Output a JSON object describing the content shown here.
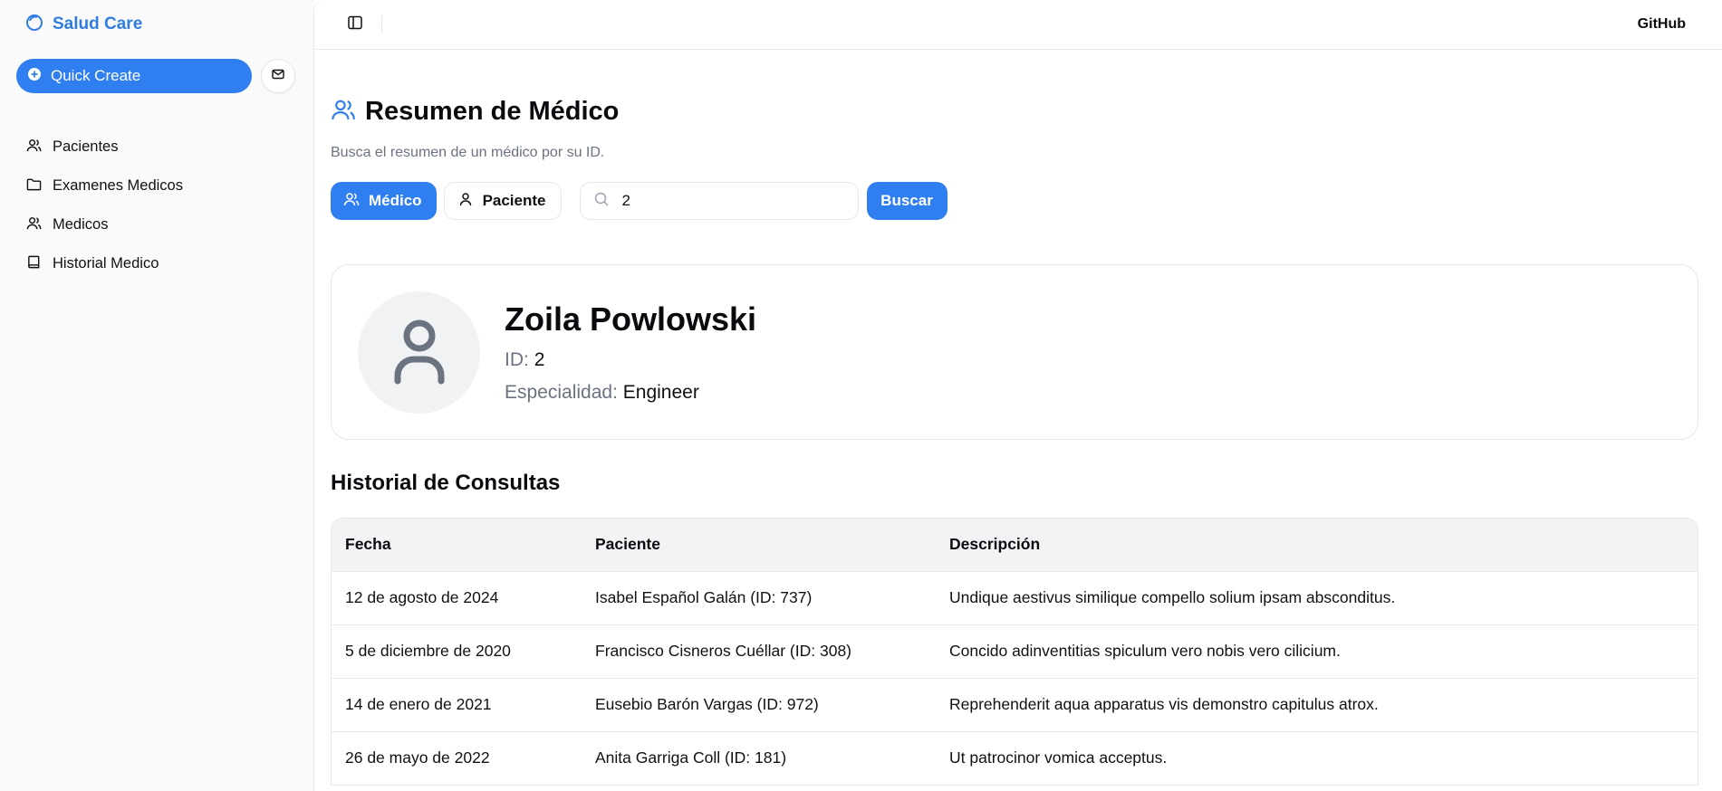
{
  "brand": {
    "name": "Salud Care",
    "color": "#2f7de1"
  },
  "sidebar": {
    "quick_create": "Quick Create",
    "items": [
      {
        "label": "Pacientes",
        "icon": "users-icon"
      },
      {
        "label": "Examenes Medicos",
        "icon": "folder-icon"
      },
      {
        "label": "Medicos",
        "icon": "users-icon"
      },
      {
        "label": "Historial Medico",
        "icon": "book-icon"
      }
    ]
  },
  "topbar": {
    "github": "GitHub"
  },
  "page": {
    "title": "Resumen de Médico",
    "subtitle": "Busca el resumen de un médico por su ID."
  },
  "filters": {
    "medico_label": "Médico",
    "paciente_label": "Paciente",
    "search_value": "2",
    "search_button": "Buscar"
  },
  "doctor": {
    "name": "Zoila Powlowski",
    "id_label": "ID:",
    "id_value": "2",
    "specialty_label": "Especialidad:",
    "specialty_value": "Engineer"
  },
  "history": {
    "title": "Historial de Consultas",
    "headers": [
      "Fecha",
      "Paciente",
      "Descripción"
    ],
    "rows": [
      [
        "12 de agosto de 2024",
        "Isabel Español Galán (ID: 737)",
        "Undique aestivus similique compello solium ipsam absconditus."
      ],
      [
        "5 de diciembre de 2020",
        "Francisco Cisneros Cuéllar (ID: 308)",
        "Concido adinventitias spiculum vero nobis vero cilicium."
      ],
      [
        "14 de enero de 2021",
        "Eusebio Barón Vargas (ID: 972)",
        "Reprehenderit aqua apparatus vis demonstro capitulus atrox."
      ],
      [
        "26 de mayo de 2022",
        "Anita Garriga Coll (ID: 181)",
        "Ut patrocinor vomica acceptus."
      ]
    ]
  },
  "colors": {
    "primary": "#2f7ff0",
    "muted_text": "#6b7280",
    "border": "#e5e7eb"
  }
}
